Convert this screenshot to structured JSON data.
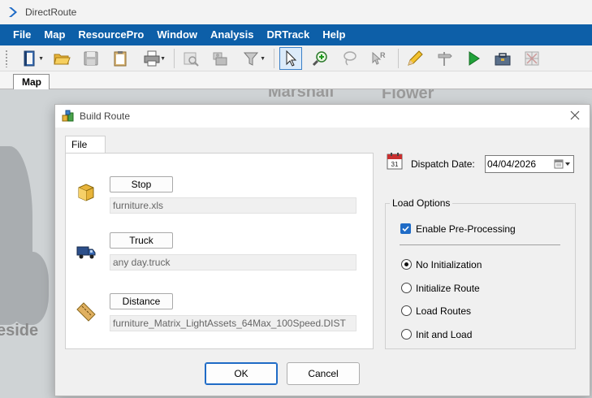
{
  "app": {
    "title": "DirectRoute"
  },
  "menu": [
    "File",
    "Map",
    "ResourcePro",
    "Window",
    "Analysis",
    "DRTrack",
    "Help"
  ],
  "toolbar": {
    "icons": [
      "book-icon",
      "open-folder-icon",
      "save-icon",
      "clipboard-icon",
      "print-icon",
      "print-preview-icon",
      "scanner-icon",
      "filter-icon",
      "pointer-icon",
      "zoom-in-icon",
      "lasso-icon",
      "route-select-icon",
      "pencil-icon",
      "signpost-icon",
      "play-icon",
      "toolbox-icon",
      "grid-icon"
    ]
  },
  "tabs": {
    "map": "Map"
  },
  "map_labels": [
    "Marshall",
    "Flower",
    "eside"
  ],
  "dialog": {
    "title": "Build Route",
    "file_tab": "File",
    "rows": [
      {
        "button": "Stop",
        "value": "furniture.xls",
        "icon": "box-icon"
      },
      {
        "button": "Truck",
        "value": "any day.truck",
        "icon": "truck-icon"
      },
      {
        "button": "Distance",
        "value": "furniture_Matrix_LightAssets_64Max_100Speed.DIST",
        "icon": "ruler-icon"
      }
    ],
    "dispatch_label": "Dispatch Date:",
    "dispatch_date": "04/04/2026",
    "load_options": {
      "label": "Load Options",
      "pre_processing": {
        "label": "Enable Pre-Processing",
        "checked": true
      },
      "radios": [
        {
          "label": "No Initialization",
          "selected": true
        },
        {
          "label": "Initialize Route",
          "selected": false
        },
        {
          "label": "Load Routes",
          "selected": false
        },
        {
          "label": "Init and Load",
          "selected": false
        }
      ]
    },
    "ok": "OK",
    "cancel": "Cancel"
  },
  "colors": {
    "menubar": "#0d5fa8",
    "accent": "#1f6bc6"
  }
}
